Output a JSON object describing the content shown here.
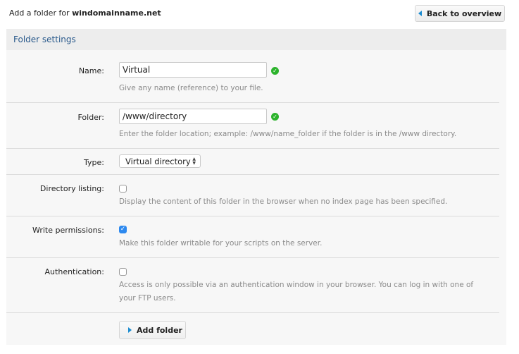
{
  "header": {
    "title_prefix": "Add a folder for ",
    "domain": "windomainname.net",
    "back_button_label": "Back to overview"
  },
  "panel": {
    "title": "Folder settings"
  },
  "form": {
    "name": {
      "label": "Name:",
      "value": "Virtual",
      "valid": true,
      "help": "Give any name (reference) to your file."
    },
    "folder": {
      "label": "Folder:",
      "value": "/www/directory",
      "valid": true,
      "help": "Enter the folder location; example: /www/name_folder if the folder is in the /www directory."
    },
    "type": {
      "label": "Type:",
      "selected": "Virtual directory"
    },
    "directory_listing": {
      "label": "Directory listing:",
      "checked": false,
      "help": "Display the content of this folder in the browser when no index page has been specified."
    },
    "write_permissions": {
      "label": "Write permissions:",
      "checked": true,
      "help": "Make this folder writable for your scripts on the server."
    },
    "authentication": {
      "label": "Authentication:",
      "checked": false,
      "help": "Access is only possible via an authentication window in your browser. You can log in with one of your FTP users."
    },
    "submit_label": "Add folder"
  },
  "colors": {
    "accent": "#1a8bd0",
    "valid": "#2cb32c",
    "checkbox_checked": "#2d89ef",
    "panel_title": "#2a5a8c"
  }
}
